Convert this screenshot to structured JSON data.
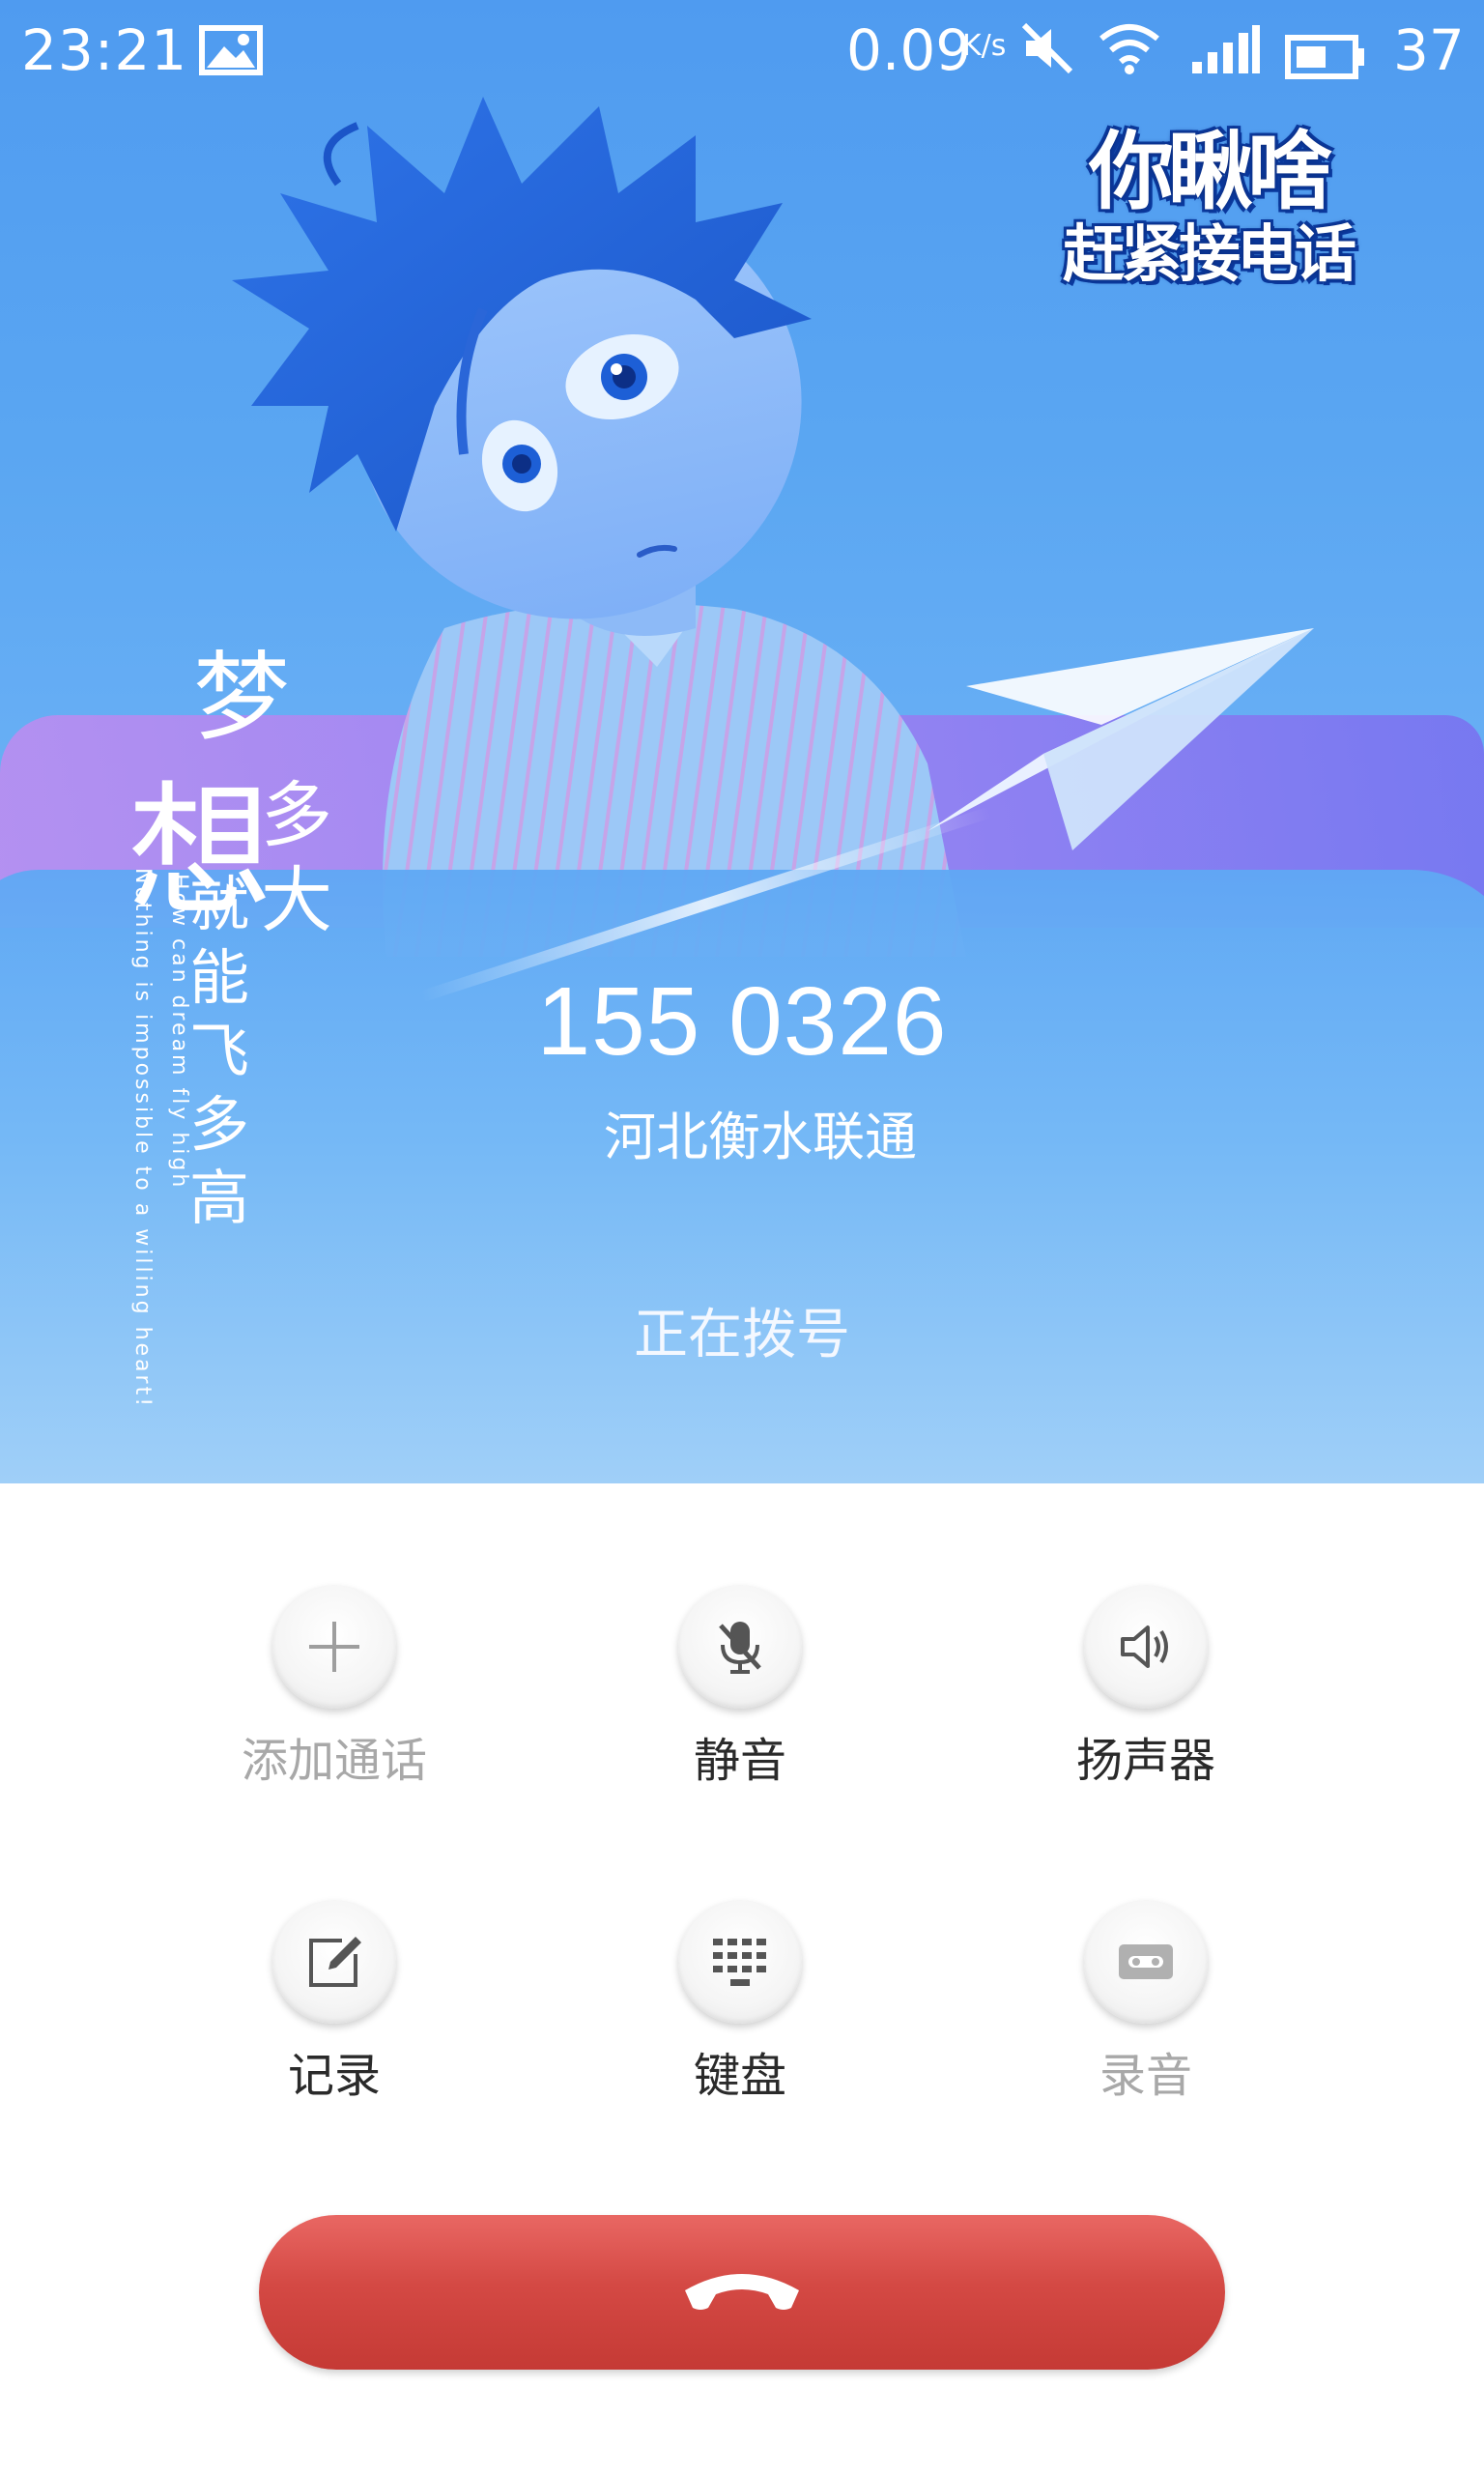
{
  "status_bar": {
    "time": "23:21",
    "net_speed": "0.09",
    "net_speed_unit": "K/s",
    "battery_level": "37"
  },
  "wallpaper": {
    "banner_line1": "你瞅啥",
    "banner_line2": "赶紧接电话",
    "calligraphy": {
      "char1": "梦",
      "char2": "想",
      "chars3": "多大",
      "chars4": "就能飞多高"
    },
    "english_line1": "How can dream fly high",
    "english_line2": "Nothing is impossible to a willing heart!"
  },
  "call": {
    "number": "155 0326",
    "location": "河北衡水联通",
    "status": "正在拨号"
  },
  "controls": {
    "add_call": "添加通话",
    "mute": "静音",
    "speaker": "扬声器",
    "notes": "记录",
    "keypad": "键盘",
    "record": "录音"
  },
  "colors": {
    "end_call": "#d44944",
    "disabled_text": "#a8a8a8",
    "label_text": "#2a2a2a"
  },
  "icons": {
    "add_call": "plus-icon",
    "mute": "mic-off-icon",
    "speaker": "speaker-icon",
    "notes": "edit-note-icon",
    "keypad": "dialpad-icon",
    "record": "cassette-icon",
    "end_call": "phone-hangup-icon"
  }
}
